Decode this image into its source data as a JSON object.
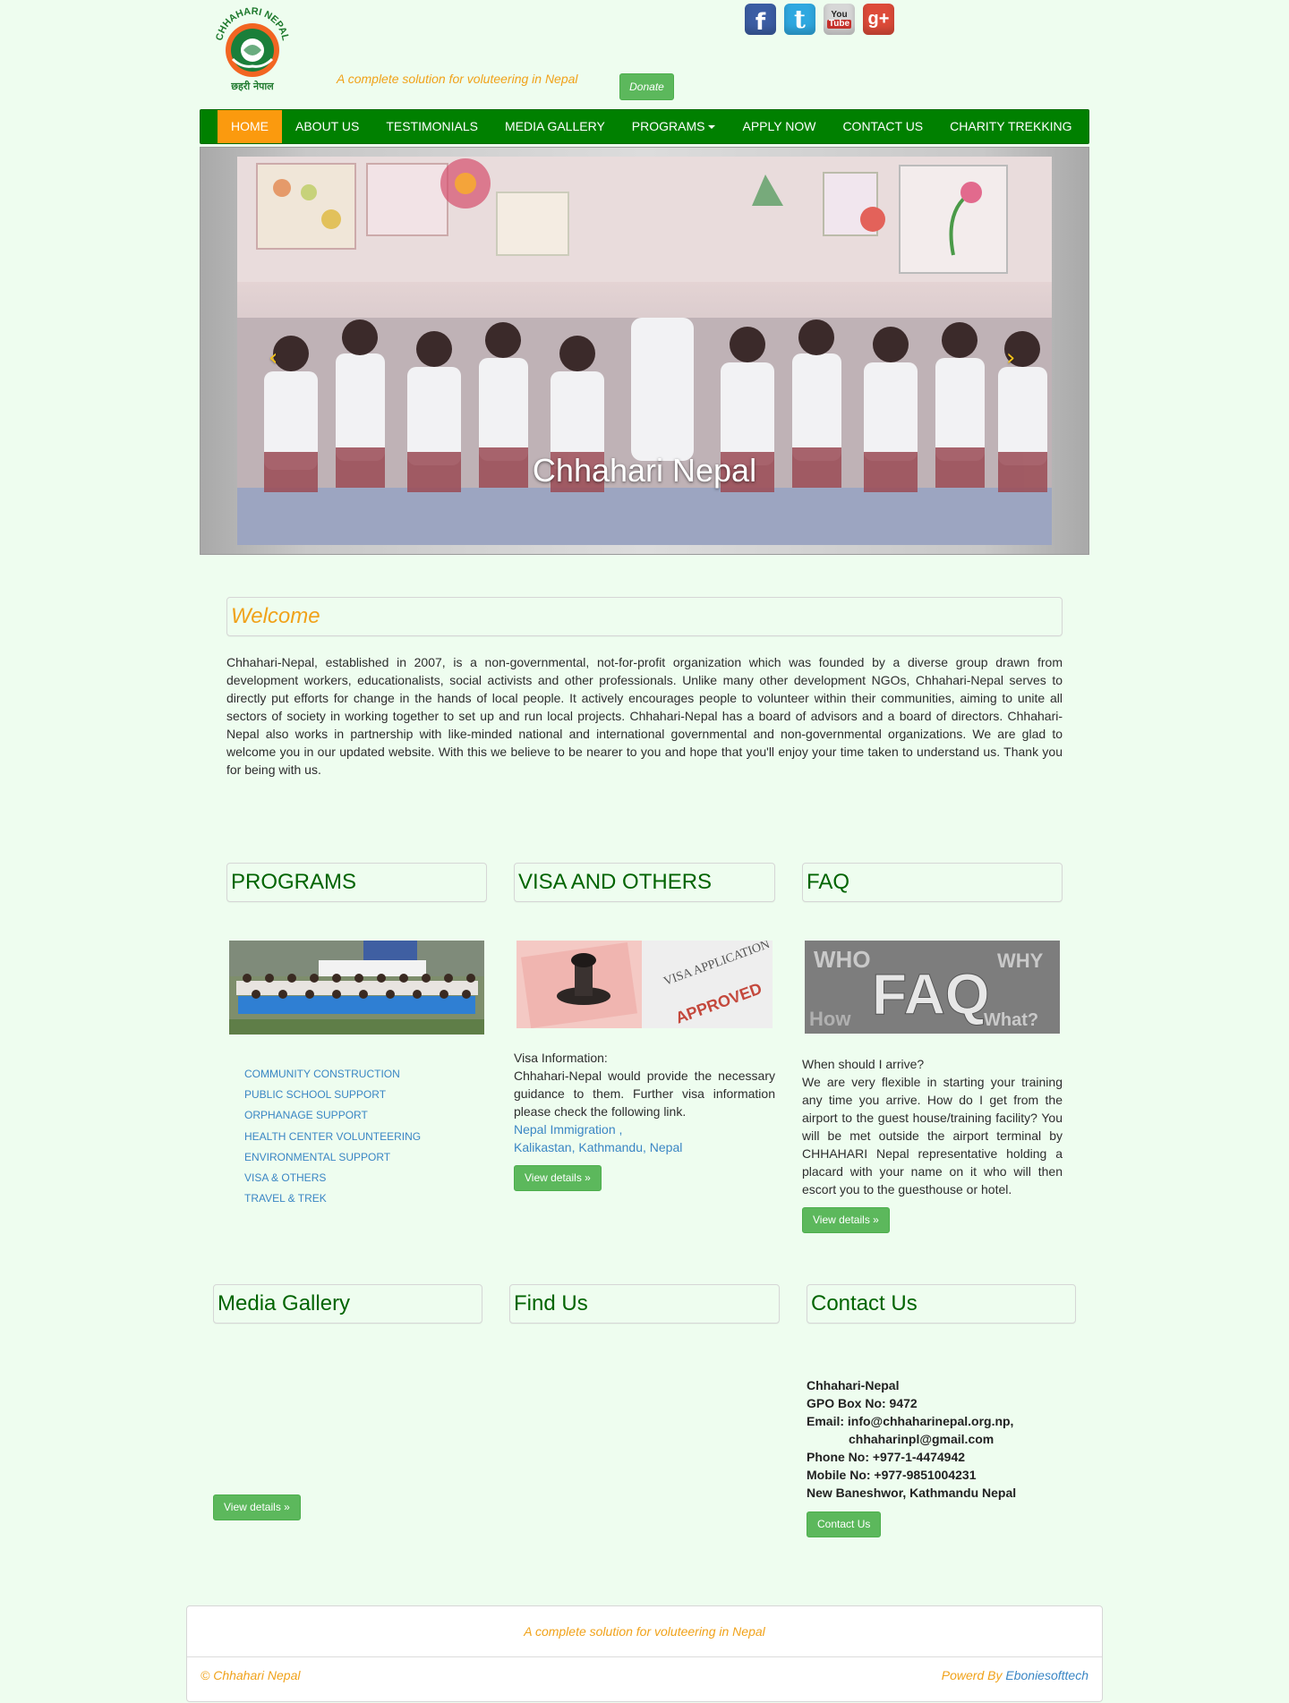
{
  "header": {
    "logo_text_top": "CHHAHARI NEPAL",
    "logo_text_bottom": "छहरी नेपाल",
    "tagline": "A complete solution for voluteering in Nepal",
    "donate_label": "Donate",
    "social": {
      "facebook": "f",
      "twitter": "t",
      "youtube_top": "You",
      "youtube_bottom": "Tube",
      "googleplus": "g+"
    }
  },
  "nav": {
    "items": [
      {
        "label": "HOME",
        "active": true
      },
      {
        "label": "ABOUT US"
      },
      {
        "label": "TESTIMONIALS"
      },
      {
        "label": "MEDIA GALLERY"
      },
      {
        "label": "PROGRAMS"
      },
      {
        "label": "APPLY NOW"
      },
      {
        "label": "CONTACT US"
      },
      {
        "label": "CHARITY TREKKING"
      }
    ]
  },
  "carousel": {
    "caption": "Chhahari Nepal",
    "prev_icon": "chevron-left-icon",
    "next_icon": "chevron-right-icon"
  },
  "welcome": {
    "title": "Welcome",
    "text": "Chhahari-Nepal, established in 2007, is a non-governmental, not-for-profit organization which was founded by a diverse group drawn from development workers, educationalists, social activists and other professionals. Unlike many other development NGOs, Chhahari-Nepal serves to directly put efforts for change in the hands of local people. It actively encourages people to volunteer within their communities, aiming to unite all sectors of society in working together to set up and run local projects. Chhahari-Nepal has a board of advisors and a board of directors. Chhahari-Nepal also works in partnership with like-minded national and international governmental and non-governmental organizations. We are glad to welcome you in our updated website. With this we believe to be nearer to you and hope that you'll enjoy your time taken to understand us. Thank you for being with us."
  },
  "programs": {
    "title": "PROGRAMS",
    "items": [
      "COMMUNITY CONSTRUCTION",
      "PUBLIC SCHOOL SUPPORT",
      "ORPHANAGE SUPPORT",
      "HEALTH CENTER VOLUNTEERING",
      "ENVIRONMENTAL SUPPORT",
      "VISA & OTHERS",
      "TRAVEL & TREK"
    ]
  },
  "visa": {
    "title": "VISA AND OTHERS",
    "image_text_1": "VISA APPLICATION",
    "image_text_2": "APPROVED",
    "heading": "Visa Information:",
    "text": "Chhahari-Nepal would provide the necessary guidance to them. Further visa information please check the following link.",
    "link_1": "Nepal Immigration ,",
    "link_2": "Kalikastan, Kathmandu, Nepal",
    "button": "View details »"
  },
  "faq": {
    "title": "FAQ",
    "image_text": "FAQ",
    "question": "When should I arrive?",
    "answer": "We are very flexible in starting your training any time you arrive. How do I get from the airport to the guest house/training facility? You will be met outside the airport terminal by CHHAHARI Nepal representative holding a placard with your name on it who will then escort you to the guesthouse or hotel.",
    "button": "View details »"
  },
  "media": {
    "title": "Media Gallery",
    "button": "View details »"
  },
  "find": {
    "title": "Find Us"
  },
  "contact": {
    "title": "Contact Us",
    "org": "Chhahari-Nepal",
    "gpo": "GPO Box No: 9472",
    "email_1": "Email: info@chhaharinepal.org.np,",
    "email_2": "chhaharinpl@gmail.com",
    "phone": "Phone No: +977-1-4474942",
    "mobile": "Mobile No: +977-9851004231",
    "address": "New Baneshwor, Kathmandu Nepal",
    "button": "Contact Us"
  },
  "footer": {
    "tagline": "A complete solution for voluteering in Nepal",
    "copyright": "© Chhahari Nepal",
    "powered_prefix": "Powerd By ",
    "powered_link": "Eboniesofttech"
  },
  "colors": {
    "background": "#eefdef",
    "nav": "#008000",
    "nav_active": "#fb9a0e",
    "accent_orange": "#f0a21a",
    "heading_green": "#006400",
    "button_green": "#5cb85c",
    "link_blue": "#3a86c4"
  }
}
